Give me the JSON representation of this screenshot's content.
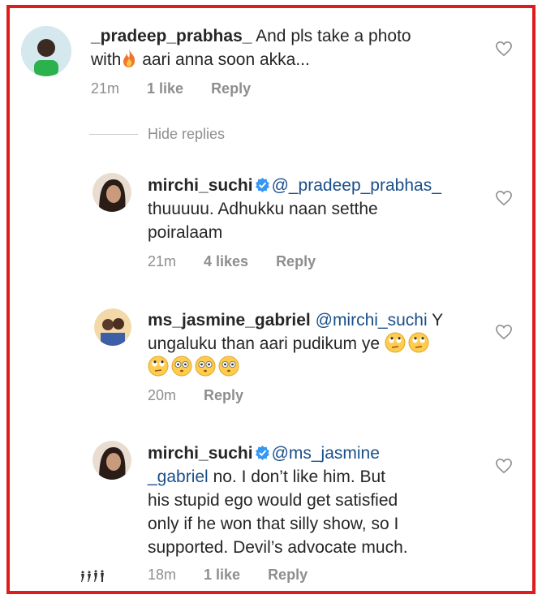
{
  "comments": [
    {
      "username": "_pradeep_prabhas_",
      "text_line1": "And pls take a photo",
      "text_line2_a": "with",
      "text_line2_b": " aari anna soon akka...",
      "time": "21m",
      "likes": "1 like",
      "reply": "Reply"
    },
    {
      "username": "mirchi_suchi",
      "mention": "@_pradeep_prabhas_",
      "text_line2": "thuuuuu. Adhukku naan setthe",
      "text_line3": "poiralaam",
      "time": "21m",
      "likes": "4 likes",
      "reply": "Reply"
    },
    {
      "username": "ms_jasmine_gabriel",
      "mention": "@mirchi_suchi",
      "text_line1_tail": " Y",
      "text_line2": "ungaluku than aari pudikum ye",
      "time": "20m",
      "reply": "Reply"
    },
    {
      "username": "mirchi_suchi",
      "mention_a": "@ms_jasmine",
      "mention_b": "_gabriel",
      "text_line2_tail": " no. I don’t like him. But",
      "text_line3": "his stupid ego would get satisfied",
      "text_line4": "only if he won that silly show, so I",
      "text_line5": "supported. Devil’s advocate much.",
      "time": "18m",
      "likes": "1 like",
      "reply": "Reply"
    }
  ],
  "hide_replies": "Hide replies",
  "watermark": "🚶‍♂️",
  "colors": {
    "frame": "#e01b1b",
    "mention": "#1a4f8a",
    "meta": "#8e8e8e",
    "verified": "#3897f0"
  }
}
